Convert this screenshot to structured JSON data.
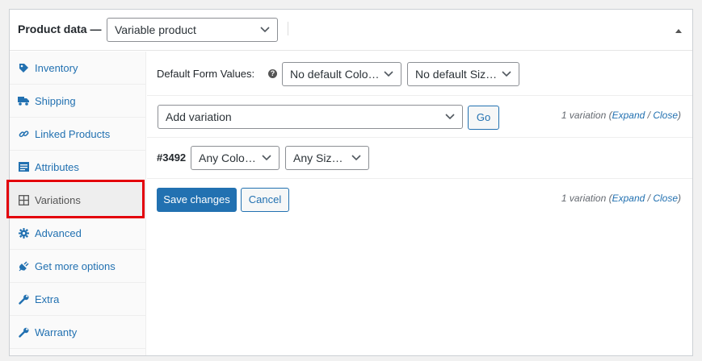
{
  "header": {
    "title": "Product data —",
    "product_type": "Variable product"
  },
  "sidebar": {
    "items": [
      {
        "label": "Inventory",
        "icon": "tag-icon"
      },
      {
        "label": "Shipping",
        "icon": "truck-icon"
      },
      {
        "label": "Linked Products",
        "icon": "link-icon"
      },
      {
        "label": "Attributes",
        "icon": "list-icon"
      },
      {
        "label": "Variations",
        "icon": "grid-icon",
        "active": true
      },
      {
        "label": "Advanced",
        "icon": "gear-icon"
      },
      {
        "label": "Get more options",
        "icon": "plugin-icon"
      },
      {
        "label": "Extra",
        "icon": "wrench-icon"
      },
      {
        "label": "Warranty",
        "icon": "wrench-icon"
      }
    ]
  },
  "defaults": {
    "label": "Default Form Values:",
    "help": "?",
    "color_select": "No default Color…",
    "size_select": "No default Size…"
  },
  "toolbar": {
    "action_select": "Add variation",
    "go_label": "Go",
    "count_prefix": "1 variation (",
    "expand": "Expand",
    "slash": " / ",
    "close": "Close",
    "count_suffix": ")"
  },
  "variation": {
    "id": "#3492",
    "color_select": "Any Color…",
    "size_select": "Any Size…"
  },
  "footer": {
    "save_label": "Save changes",
    "cancel_label": "Cancel",
    "count_prefix": "1 variation (",
    "expand": "Expand",
    "slash": " / ",
    "close": "Close",
    "count_suffix": ")"
  },
  "colors": {
    "accent": "#2271b1",
    "highlight": "#e3000b"
  }
}
